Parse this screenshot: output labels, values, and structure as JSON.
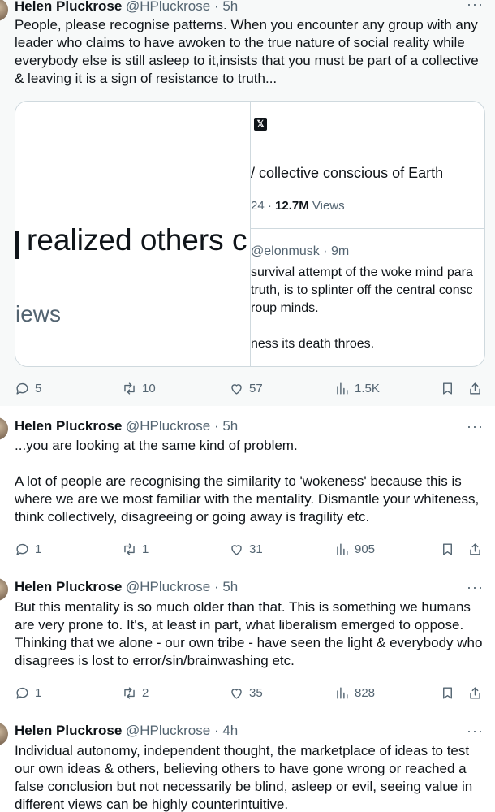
{
  "tweets": [
    {
      "name": "Helen Pluckrose",
      "handle": "@HPluckrose",
      "time": "· 5h",
      "more": "···",
      "text": "People, please recognise patterns. When you encounter any group with any leader who claims to have awoken to the true nature of social reality while everybody else is still asleep to it,insists that you must be part of a collective & leaving it is a sign of resistance to truth...",
      "replies": "5",
      "retweets": "10",
      "likes": "57",
      "views": "1.5K"
    },
    {
      "name": "Helen Pluckrose",
      "handle": "@HPluckrose",
      "time": "· 5h",
      "more": "···",
      "text": "...you are looking at the same kind of problem.\n\nA lot of people are recognising the similarity to 'wokeness' because this is where we are we most familiar with the mentality. Dismantle your whiteness, think collectively, disagreeing or going away is fragility etc.",
      "replies": "1",
      "retweets": "1",
      "likes": "31",
      "views": "905"
    },
    {
      "name": "Helen Pluckrose",
      "handle": "@HPluckrose",
      "time": "· 5h",
      "more": "···",
      "text": "But this mentality is so much older than that. This is something we humans are very prone to. It's, at least in part, what liberalism emerged to oppose. Thinking that we alone - our own tribe - have seen the light & everybody who disagrees is lost to error/sin/brainwashing etc.",
      "replies": "1",
      "retweets": "2",
      "likes": "35",
      "views": "828"
    },
    {
      "name": "Helen Pluckrose",
      "handle": "@HPluckrose",
      "time": "· 4h",
      "more": "···",
      "text": "Individual autonomy, independent thought, the marketplace of ideas to test our own ideas & others, believing others to have gone wrong or reached a false conclusion but not necessarily be blind, asleep or evil, seeing value in different views can be highly counterintuitive."
    }
  ],
  "quote_card": {
    "left_big_text": "realized others c",
    "left_views_text": "iews",
    "x_logo": "𝕏",
    "title": "/ collective conscious of Earth",
    "stats_prefix": "24 · ",
    "stats_views": "12.7M",
    "stats_suffix": " Views",
    "quoted_handle": "@elonmusk · 9m",
    "lines": [
      "survival attempt of the woke mind para",
      "truth, is to splinter off the central consc",
      "roup minds.",
      "ness its death throes."
    ]
  }
}
